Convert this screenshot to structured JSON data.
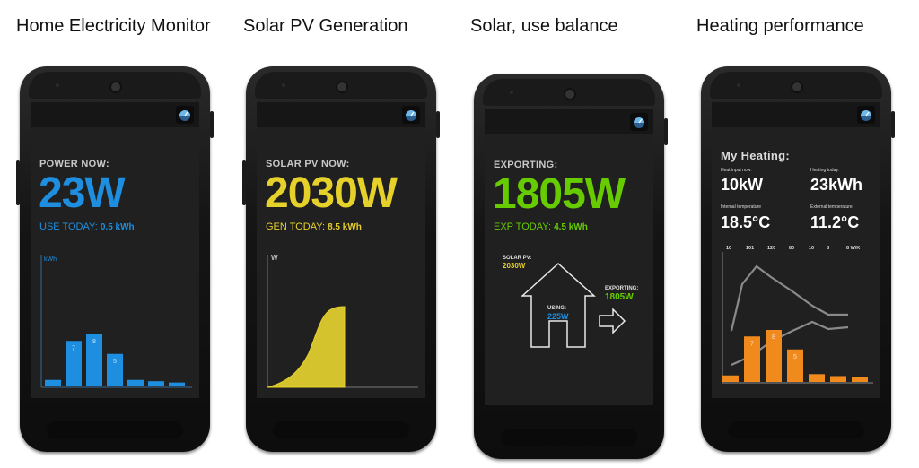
{
  "captions": [
    "Home Electricity Monitor",
    "Solar PV Generation",
    "Solar, use balance",
    "Heating performance"
  ],
  "colors": {
    "blue": "#1e8fe0",
    "yellow": "#e6d12a",
    "green": "#66cc00",
    "orange": "#f08a1c"
  },
  "phone1": {
    "label": "POWER NOW:",
    "value": "23W",
    "sub_label": "USE TODAY:",
    "sub_value": "0.5 kWh",
    "axis_label": "kWh",
    "bars": [
      {
        "value": 1,
        "label": ""
      },
      {
        "value": 7,
        "label": "7"
      },
      {
        "value": 8,
        "label": "8"
      },
      {
        "value": 5,
        "label": "5"
      },
      {
        "value": 1,
        "label": ""
      },
      {
        "value": 0.8,
        "label": ""
      },
      {
        "value": 0.6,
        "label": ""
      }
    ]
  },
  "phone2": {
    "label": "SOLAR PV NOW:",
    "value": "2030W",
    "sub_label": "GEN TODAY:",
    "sub_value": "8.5 kWh",
    "axis_label": "W"
  },
  "phone3": {
    "label": "EXPORTING:",
    "value": "1805W",
    "sub_label": "EXP TODAY:",
    "sub_value": "4.5 kWh",
    "solar_label": "SOLAR PV:",
    "solar_value": "2030W",
    "using_label": "USING:",
    "using_value": "225W",
    "exporting_label": "EXPORTING:",
    "exporting_value": "1805W"
  },
  "phone4": {
    "title": "My Heating:",
    "heat_input_label": "Heat input now:",
    "heat_input_value": "10kW",
    "heating_today_label": "Heating today:",
    "heating_today_value": "23kWh",
    "internal_label": "Internal temperature",
    "internal_value": "18.5°C",
    "external_label": "External temperature:",
    "external_value": "11.2°C",
    "top_numbers": [
      "10",
      "101",
      "120",
      "80",
      "10",
      "8",
      "8 W/K"
    ],
    "bars": [
      {
        "value": 1,
        "label": ""
      },
      {
        "value": 7,
        "label": "7"
      },
      {
        "value": 8,
        "label": "8"
      },
      {
        "value": 5,
        "label": "5"
      },
      {
        "value": 1.2,
        "label": ""
      },
      {
        "value": 0.9,
        "label": ""
      },
      {
        "value": 0.7,
        "label": ""
      }
    ]
  }
}
